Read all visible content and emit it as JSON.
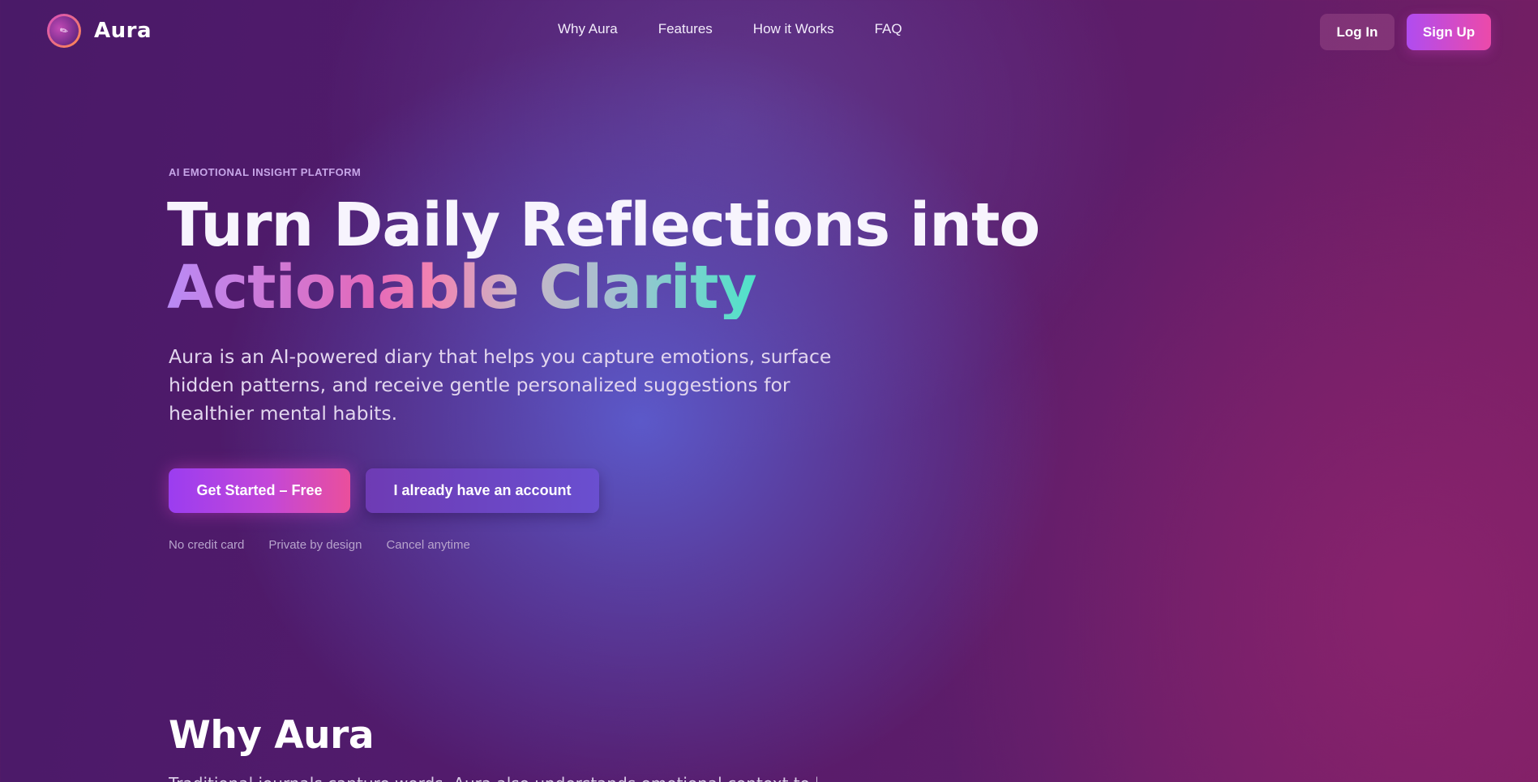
{
  "nav": {
    "brand": "Aura",
    "logo_icon": "aura-orb-icon",
    "links": [
      "Why Aura",
      "Features",
      "How it Works",
      "FAQ"
    ],
    "login_label": "Log In",
    "signup_label": "Sign Up"
  },
  "hero": {
    "eyebrow": "AI EMOTIONAL INSIGHT PLATFORM",
    "headline_line1": "Turn Daily Reflections into",
    "headline_line2": "Actionable Clarity",
    "subtitle": "Aura is an AI-powered diary that helps you capture emotions, surface hidden patterns, and receive gentle personalized suggestions for healthier mental habits.",
    "primary_cta": "Get Started – Free",
    "secondary_cta": "I already have an account",
    "trust_points": [
      "No credit card",
      "Private by design",
      "Cancel anytime"
    ]
  },
  "why": {
    "title": "Why Aura",
    "body_partial": "Traditional journals capture words. Aura also understands emotional context to help you"
  },
  "colors": {
    "background_start": "#4a1a68",
    "background_end": "#7a1e62",
    "accent_purple": "#9b3df0",
    "accent_pink": "#ea4f9c",
    "accent_teal": "#4fe3c9"
  }
}
